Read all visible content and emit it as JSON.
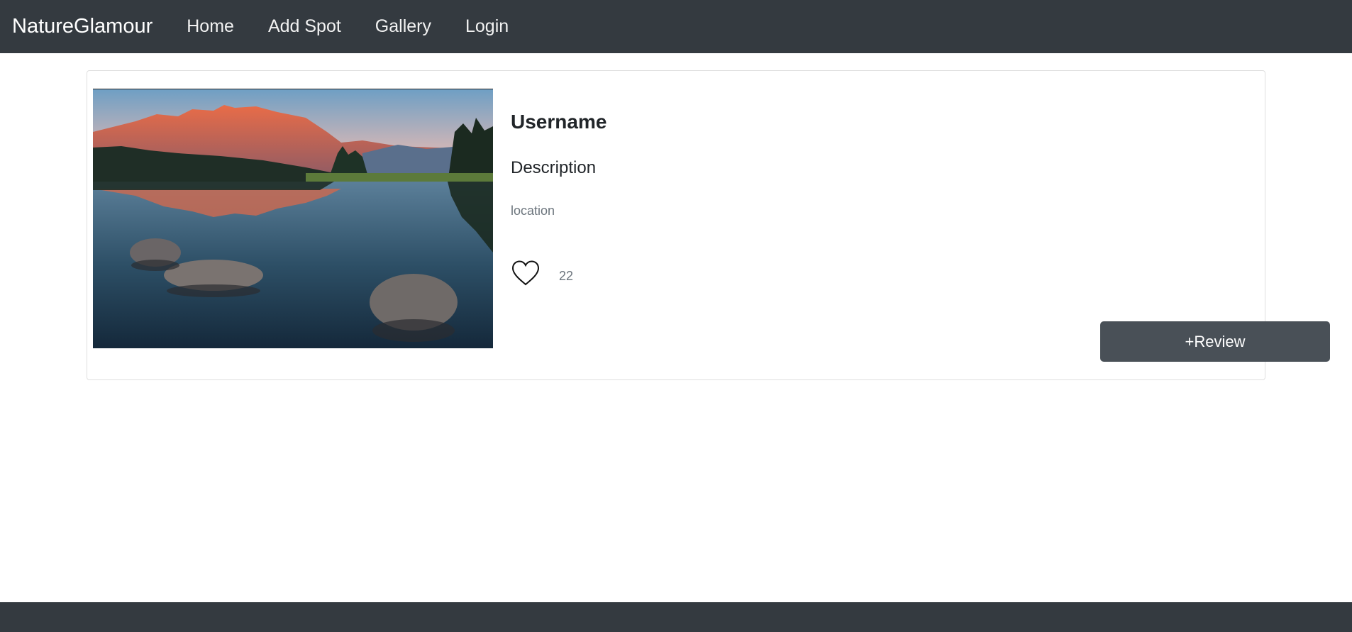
{
  "navbar": {
    "brand": "NatureGlamour",
    "links": [
      {
        "label": "Home"
      },
      {
        "label": "Add Spot"
      },
      {
        "label": "Gallery"
      },
      {
        "label": "Login"
      }
    ]
  },
  "card": {
    "image_subject": "mountain lake reflection at sunset",
    "username": "Username",
    "description": "Description",
    "location": "location",
    "like_icon": "heart-icon",
    "likes": "22",
    "review_button": "+Review"
  },
  "colors": {
    "navbar_bg": "#343a40",
    "button_bg": "#495057",
    "muted_text": "#6c757d"
  }
}
